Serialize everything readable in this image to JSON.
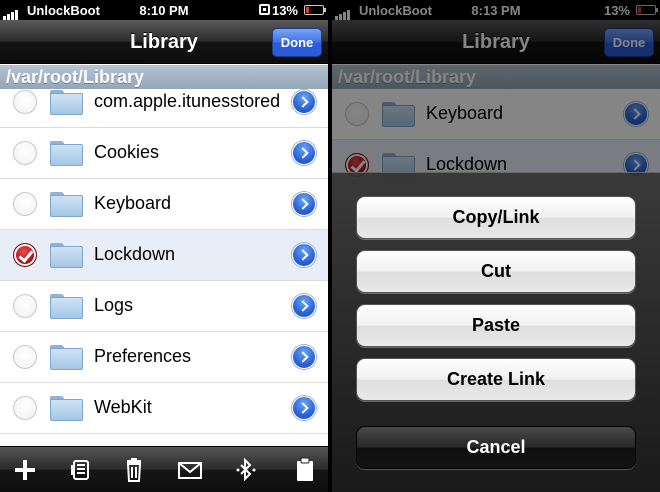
{
  "left": {
    "status": {
      "carrier": "UnlockBoot",
      "time": "8:10 PM",
      "battery": "13%"
    },
    "nav": {
      "title": "Library",
      "done_label": "Done"
    },
    "path": "/var/root/Library",
    "rows": [
      {
        "label": "com.apple.itunesstored",
        "checked": false
      },
      {
        "label": "Cookies",
        "checked": false
      },
      {
        "label": "Keyboard",
        "checked": false
      },
      {
        "label": "Lockdown",
        "checked": true
      },
      {
        "label": "Logs",
        "checked": false
      },
      {
        "label": "Preferences",
        "checked": false
      },
      {
        "label": "WebKit",
        "checked": false
      }
    ],
    "toolbar": [
      "plus-icon",
      "compress-icon",
      "trash-icon",
      "mail-icon",
      "bluetooth-icon",
      "clipboard-icon"
    ]
  },
  "right": {
    "status": {
      "carrier": "UnlockBoot",
      "time": "8:13 PM",
      "battery": "13%"
    },
    "nav": {
      "title": "Library",
      "done_label": "Done"
    },
    "path": "/var/root/Library",
    "rows": [
      {
        "label": "Keyboard",
        "checked": false
      },
      {
        "label": "Lockdown",
        "checked": true
      }
    ],
    "actions": {
      "copy_link": "Copy/Link",
      "cut": "Cut",
      "paste": "Paste",
      "create_link": "Create Link",
      "cancel": "Cancel"
    }
  },
  "colors": {
    "accent": "#2b5bd6",
    "checked": "#b01018",
    "path_header": "#a4b4c4"
  }
}
